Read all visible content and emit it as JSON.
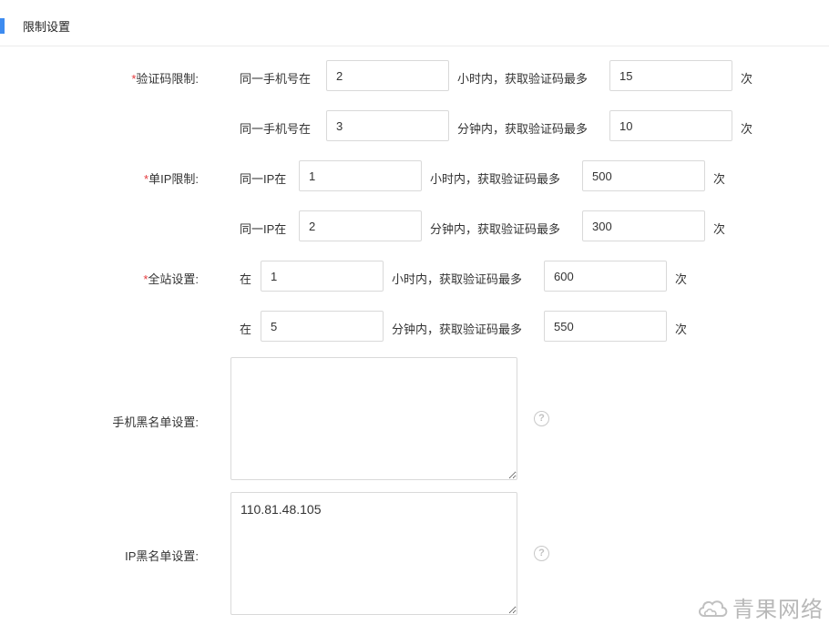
{
  "section": {
    "title": "限制设置"
  },
  "form": {
    "verify_code": {
      "required_mark": "*",
      "label": "验证码限制:",
      "row1": {
        "prefix": "同一手机号在",
        "value1": "2",
        "middle": "小时内，获取验证码最多",
        "value2": "15",
        "suffix": "次"
      },
      "row2": {
        "prefix": "同一手机号在",
        "value1": "3",
        "middle": "分钟内，获取验证码最多",
        "value2": "10",
        "suffix": "次"
      }
    },
    "single_ip": {
      "required_mark": "*",
      "label": "单IP限制:",
      "row1": {
        "prefix": "同一IP在",
        "value1": "1",
        "middle": "小时内，获取验证码最多",
        "value2": "500",
        "suffix": "次"
      },
      "row2": {
        "prefix": "同一IP在",
        "value1": "2",
        "middle": "分钟内，获取验证码最多",
        "value2": "300",
        "suffix": "次"
      }
    },
    "site_wide": {
      "required_mark": "*",
      "label": "全站设置:",
      "row1": {
        "prefix": "在",
        "value1": "1",
        "middle": "小时内，获取验证码最多",
        "value2": "600",
        "suffix": "次"
      },
      "row2": {
        "prefix": "在",
        "value1": "5",
        "middle": "分钟内，获取验证码最多",
        "value2": "550",
        "suffix": "次"
      }
    },
    "phone_blacklist": {
      "label": "手机黑名单设置:",
      "value": "",
      "help": "?"
    },
    "ip_blacklist": {
      "label": "IP黑名单设置:",
      "value": "110.81.48.105",
      "help": "?"
    }
  },
  "watermark": {
    "text": "青果网络",
    "icon": "cloud-logo-icon"
  },
  "colors": {
    "accent": "#3d8bf0",
    "required": "#e4393c",
    "border": "#d9d9d9"
  }
}
